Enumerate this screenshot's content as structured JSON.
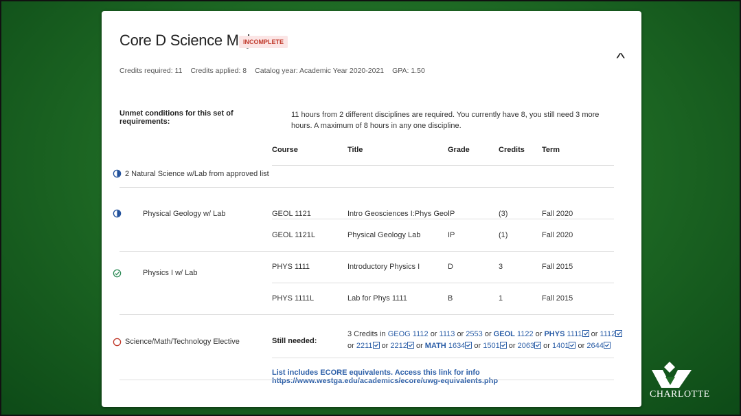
{
  "card": {
    "title": "Core D Science Majors",
    "status_badge": "INCOMPLETE",
    "collapse_glyph": "^",
    "meta": {
      "credits_required": "Credits required:  11",
      "credits_applied": "Credits applied:  8",
      "catalog_year": "Catalog year:  Academic Year 2020-2021",
      "gpa": "GPA:  1.50"
    },
    "unmet_label": "Unmet conditions for this set of requirements:",
    "unmet_text": "11 hours from 2 different disciplines are required. You currently have 8, you still need 3 more hours. A maximum of 8 hours in any one discipline."
  },
  "table": {
    "headers": {
      "course": "Course",
      "title": "Title",
      "grade": "Grade",
      "credits": "Credits",
      "term": "Term"
    },
    "group_label": "2 Natural Science w/Lab from approved list",
    "requirements": [
      {
        "label": "Physical Geology w/ Lab",
        "status_icon": "in-progress-icon",
        "rows": [
          {
            "course": "GEOL 1121",
            "title": "Intro Geosciences I:Phys Geol",
            "grade": "IP",
            "credits": "(3)",
            "term": "Fall 2020"
          },
          {
            "course": "GEOL 1121L",
            "title": "Physical Geology Lab",
            "grade": "IP",
            "credits": "(1)",
            "term": "Fall 2020"
          }
        ]
      },
      {
        "label": "Physics I w/ Lab",
        "status_icon": "complete-check-icon",
        "rows": [
          {
            "course": "PHYS 1111",
            "title": "Introductory Physics I",
            "grade": "D",
            "credits": "3",
            "term": "Fall 2015"
          },
          {
            "course": "PHYS 1111L",
            "title": "Lab for Phys 1111",
            "grade": "B",
            "credits": "1",
            "term": "Fall 2015"
          }
        ]
      },
      {
        "label": "Science/Math/Technology Elective",
        "status_icon": "not-started-icon",
        "still_needed_label": "Still needed:",
        "still_needed": {
          "prefix": "3 Credits in",
          "geog": "GEOG",
          "geog_1112": "1112",
          "geog_1113": "1113",
          "geog_2553": "2553",
          "geol": "GEOL",
          "geol_1122": "1122",
          "phys": "PHYS",
          "phys_1111": "1111",
          "phys_1112": "1112",
          "phys_2211": "2211",
          "phys_2212": "2212",
          "math": "MATH",
          "math_1634": "1634",
          "math_1501": "1501",
          "math_2063": "2063",
          "math_1401": "1401",
          "math_2644": "2644",
          "or": "or"
        },
        "ecore_link": "List includes ECORE equivalents. Access this link for info https://www.westga.edu/academics/ecore/uwg-equivalents.php"
      }
    ]
  },
  "logo": {
    "text": "CHARLOTTE",
    "icon": "charlotte-crown-logo"
  },
  "colors": {
    "background_green": "#1f6b25",
    "link_blue": "#2b5ea7",
    "badge_red": "#c0392b",
    "badge_bg": "#fbe5e5",
    "check_green": "#2e8b57",
    "in_progress_blue": "#1f4f9b",
    "not_started_red": "#c0392b"
  }
}
